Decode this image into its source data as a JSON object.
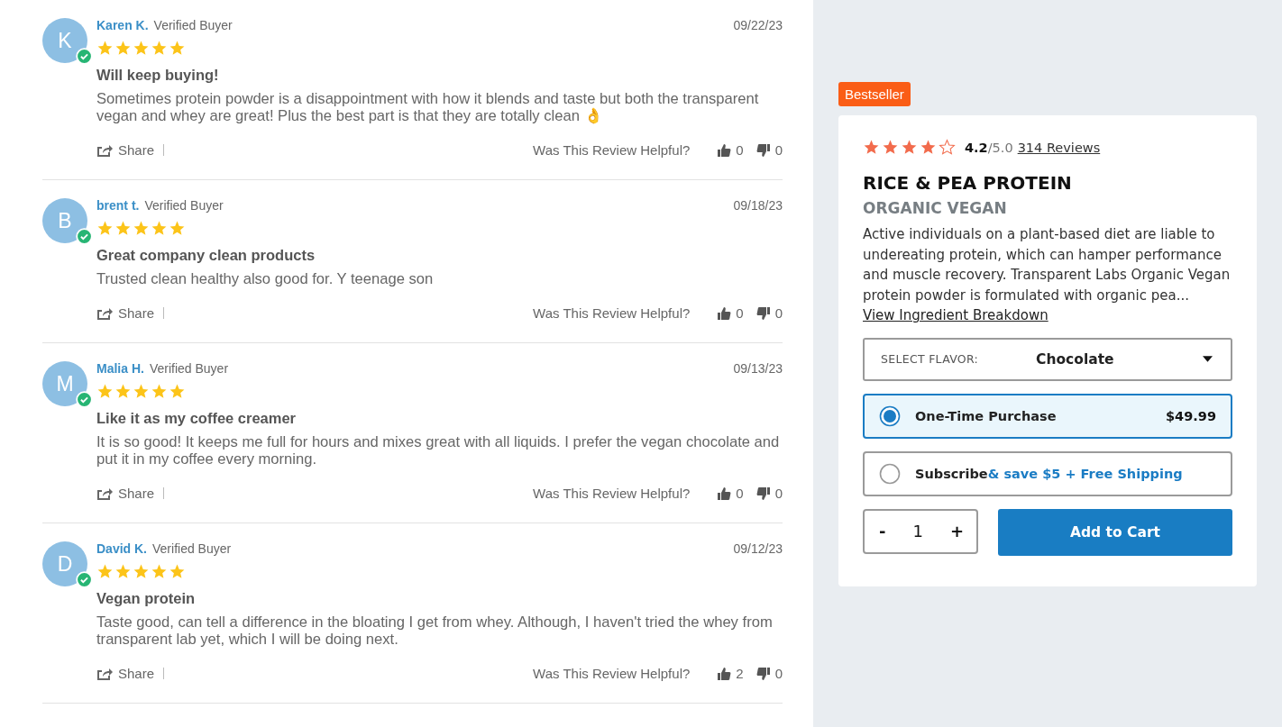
{
  "reviews": [
    {
      "initial": "K",
      "name": "Karen K.",
      "badge": "Verified Buyer",
      "verified": true,
      "date": "09/22/23",
      "stars": 5,
      "title": "Will keep buying!",
      "body": "Sometimes protein powder is a disappointment with how it blends and taste but both the transparent vegan and whey are great! Plus the best part is that they are totally clean 👌",
      "share": "Share",
      "helpful": "Was This Review Helpful?",
      "up": "0",
      "down": "0"
    },
    {
      "initial": "B",
      "name": "brent t.",
      "badge": "Verified Buyer",
      "verified": true,
      "date": "09/18/23",
      "stars": 5,
      "title": "Great company clean products",
      "body": "Trusted clean healthy also good for. Y teenage son",
      "share": "Share",
      "helpful": "Was This Review Helpful?",
      "up": "0",
      "down": "0"
    },
    {
      "initial": "M",
      "name": "Malia H.",
      "badge": "Verified Buyer",
      "verified": true,
      "date": "09/13/23",
      "stars": 5,
      "title": "Like it as my coffee creamer",
      "body": "It is so good! It keeps me full for hours and mixes great with all liquids. I prefer the vegan chocolate and put it in my coffee every morning.",
      "share": "Share",
      "helpful": "Was This Review Helpful?",
      "up": "0",
      "down": "0"
    },
    {
      "initial": "D",
      "name": "David K.",
      "badge": "Verified Buyer",
      "verified": true,
      "date": "09/12/23",
      "stars": 5,
      "title": "Vegan protein",
      "body": "Taste good, can tell a difference in the bloating I get from whey. Although, I haven't tried the whey from transparent lab yet, which I will be doing next.",
      "share": "Share",
      "helpful": "Was This Review Helpful?",
      "up": "2",
      "down": "0"
    }
  ],
  "product": {
    "tag": "Bestseller",
    "stars": 4,
    "rating": "4.2",
    "out_of": "/5.0",
    "reviews_link": "314 Reviews",
    "name": "RICE & PEA PROTEIN",
    "subtitle": "ORGANIC VEGAN",
    "description": "Active individuals on a plant-based diet are liable to undereating protein, which can hamper performance and muscle recovery. Transparent Labs Organic Vegan protein powder is formulated with organic pea...",
    "description_link": "View Ingredient Breakdown",
    "flavor": {
      "label": "SELECT FLAVOR:",
      "value": "Chocolate"
    },
    "options": [
      {
        "label": "One-Time Purchase",
        "price": "$49.99",
        "selected": true
      },
      {
        "label": "Subscribe",
        "extra": "& save $5 + Free Shipping",
        "selected": false
      }
    ],
    "quantity": {
      "minus": "-",
      "value": "1",
      "plus": "+"
    },
    "cart": "Add to Cart"
  }
}
